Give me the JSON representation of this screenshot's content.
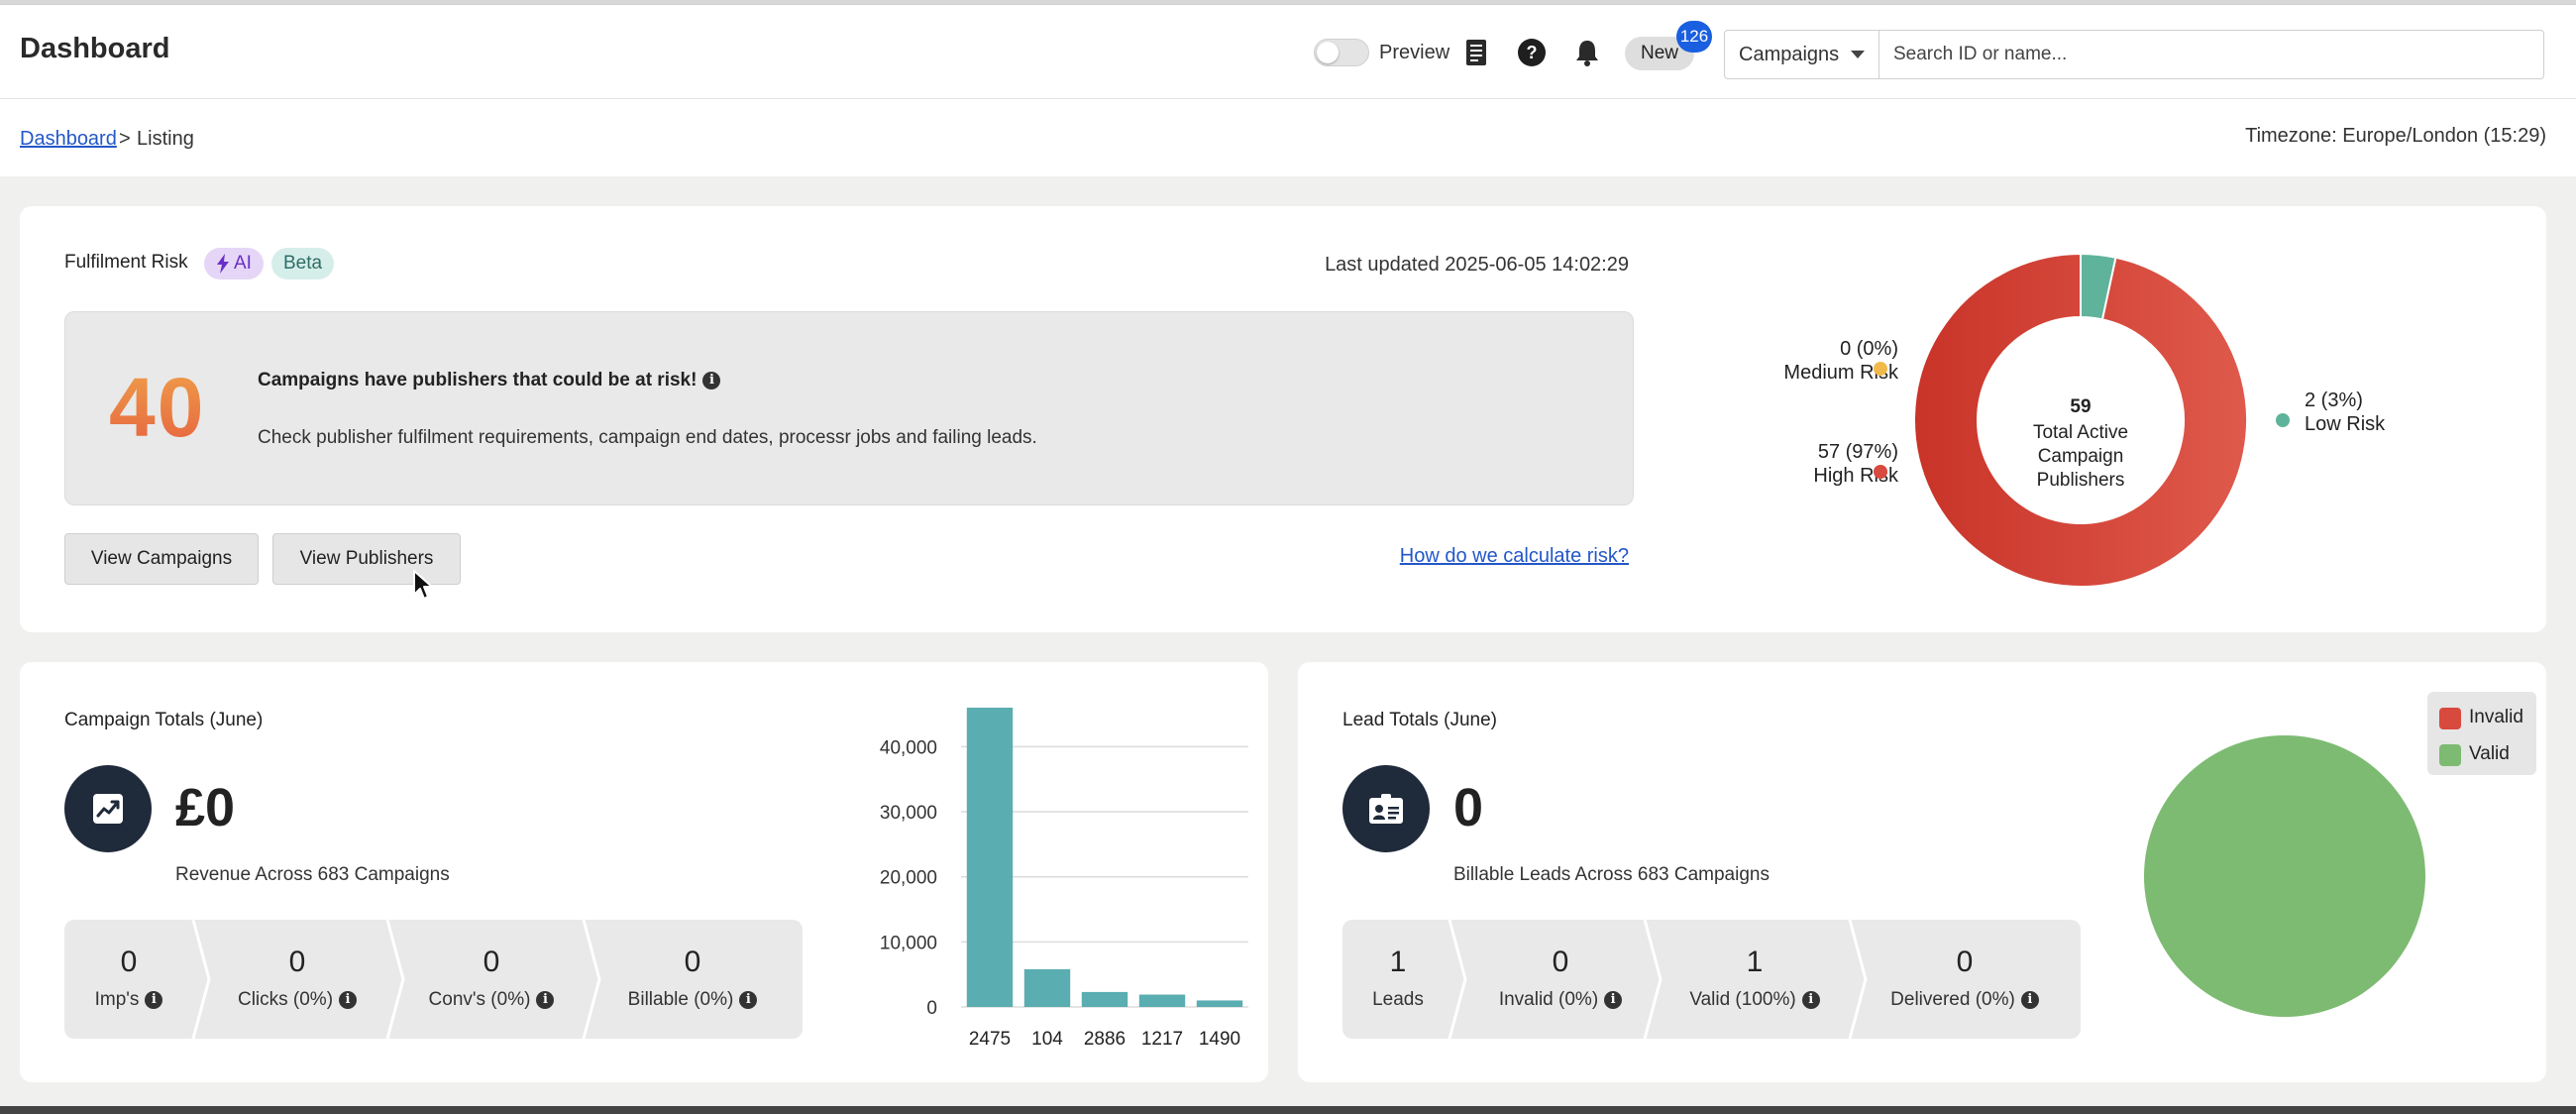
{
  "header": {
    "title": "Dashboard",
    "preview_label": "Preview",
    "new_label": "New",
    "new_count": "126",
    "search_type": "Campaigns",
    "search_placeholder": "Search ID or name..."
  },
  "breadcrumb": {
    "root": "Dashboard",
    "separator": ">",
    "current": "Listing"
  },
  "timezone": "Timezone: Europe/London (15:29)",
  "risk": {
    "title": "Fulfilment Risk",
    "ai_label": "AI",
    "beta_label": "Beta",
    "last_updated": "Last updated 2025-06-05 14:02:29",
    "count": "40",
    "headline": "Campaigns have publishers that could be at risk!",
    "subtext": "Check publisher fulfilment requirements, campaign end dates, processr jobs and failing leads.",
    "view_campaigns": "View Campaigns",
    "view_publishers": "View Publishers",
    "how_link": "How do we calculate risk?",
    "donut": {
      "total": "59",
      "center_line1": "Total Active",
      "center_line2": "Campaign",
      "center_line3": "Publishers",
      "medium_value": "0 (0%)",
      "medium_label": "Medium Risk",
      "high_value": "57 (97%)",
      "high_label": "High Risk",
      "low_value": "2 (3%)",
      "low_label": "Low Risk",
      "colors": {
        "high": "#d8493e",
        "low": "#5fb39a",
        "medium": "#f0b94a"
      }
    }
  },
  "campaign_totals": {
    "title": "Campaign Totals (June)",
    "revenue": "£0",
    "revenue_sub": "Revenue Across 683 Campaigns",
    "stats": [
      {
        "value": "0",
        "label": "Imp's"
      },
      {
        "value": "0",
        "label": "Clicks (0%)"
      },
      {
        "value": "0",
        "label": "Conv's (0%)"
      },
      {
        "value": "0",
        "label": "Billable (0%)"
      }
    ]
  },
  "lead_totals": {
    "title": "Lead Totals (June)",
    "count": "0",
    "count_sub": "Billable Leads Across 683 Campaigns",
    "stats": [
      {
        "value": "1",
        "label": "Leads"
      },
      {
        "value": "0",
        "label": "Invalid (0%)"
      },
      {
        "value": "1",
        "label": "Valid (100%)"
      },
      {
        "value": "0",
        "label": "Delivered (0%)"
      }
    ],
    "legend": {
      "invalid": "Invalid",
      "valid": "Valid"
    },
    "colors": {
      "invalid": "#d8493e",
      "valid": "#7dbb72"
    }
  },
  "chart_data": [
    {
      "type": "pie",
      "labels": [
        "High Risk",
        "Low Risk",
        "Medium Risk"
      ],
      "values": [
        57,
        2,
        0
      ],
      "center": "59 Total Active Campaign Publishers"
    },
    {
      "type": "bar",
      "categories": [
        "2475",
        "104",
        "2886",
        "1217",
        "1490"
      ],
      "values": [
        46000,
        5800,
        2300,
        1900,
        1000
      ],
      "yticks": [
        "0",
        "10,000",
        "20,000",
        "30,000",
        "40,000"
      ],
      "ylim": [
        0,
        46000
      ],
      "color": "#5aadb0"
    },
    {
      "type": "pie",
      "labels": [
        "Invalid",
        "Valid"
      ],
      "values": [
        0,
        1
      ]
    }
  ]
}
